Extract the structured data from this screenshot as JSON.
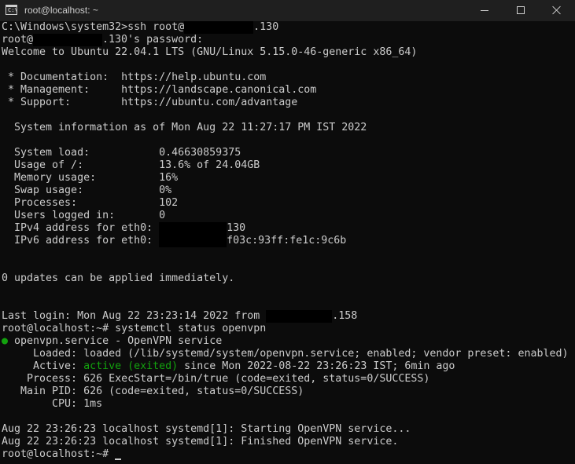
{
  "window": {
    "title": "root@localhost: ~",
    "app_icon": "cmd-icon",
    "icon_text": "C:\\"
  },
  "controls": {
    "minimize_icon": "minimize-icon",
    "maximize_icon": "maximize-icon",
    "close_icon": "close-icon"
  },
  "colors": {
    "background": "#0c0c0c",
    "text": "#cccccc",
    "titlebar": "#1f1f1f",
    "active_green": "#13a10e",
    "redaction": "#000000"
  },
  "terminal": {
    "l1a": "C:\\Windows\\system32>ssh root@",
    "l1b": ".130",
    "l2a": "root@",
    "l2b": ".130's password:",
    "l3": "Welcome to Ubuntu 22.04.1 LTS (GNU/Linux 5.15.0-46-generic x86_64)",
    "l5": " * Documentation:  https://help.ubuntu.com",
    "l6": " * Management:     https://landscape.canonical.com",
    "l7": " * Support:        https://ubuntu.com/advantage",
    "l9": "  System information as of Mon Aug 22 11:27:17 PM IST 2022",
    "l11": "  System load:           0.46630859375",
    "l12": "  Usage of /:            13.6% of 24.04GB",
    "l13": "  Memory usage:          16%",
    "l14": "  Swap usage:            0%",
    "l15": "  Processes:             102",
    "l16": "  Users logged in:       0",
    "l17a": "  IPv4 address for eth0: ",
    "l17b": "130",
    "l18a": "  IPv6 address for eth0: ",
    "l18b": "f03c:93ff:fe1c:9c6b",
    "l21": "0 updates can be applied immediately.",
    "l24a": "Last login: Mon Aug 22 23:23:14 2022 from ",
    "l24b": ".158",
    "l25": "root@localhost:~# systemctl status openvpn",
    "l26a": "●",
    "l26b": " openvpn.service - OpenVPN service",
    "l27": "     Loaded: loaded (/lib/systemd/system/openvpn.service; enabled; vendor preset: enabled)",
    "l28a": "     Active: ",
    "l28b": "active (exited)",
    "l28c": " since Mon 2022-08-22 23:26:23 IST; 6min ago",
    "l29": "    Process: 626 ExecStart=/bin/true (code=exited, status=0/SUCCESS)",
    "l30": "   Main PID: 626 (code=exited, status=0/SUCCESS)",
    "l31": "        CPU: 1ms",
    "l33": "Aug 22 23:26:23 localhost systemd[1]: Starting OpenVPN service...",
    "l34": "Aug 22 23:26:23 localhost systemd[1]: Finished OpenVPN service.",
    "l35": "root@localhost:~# "
  }
}
